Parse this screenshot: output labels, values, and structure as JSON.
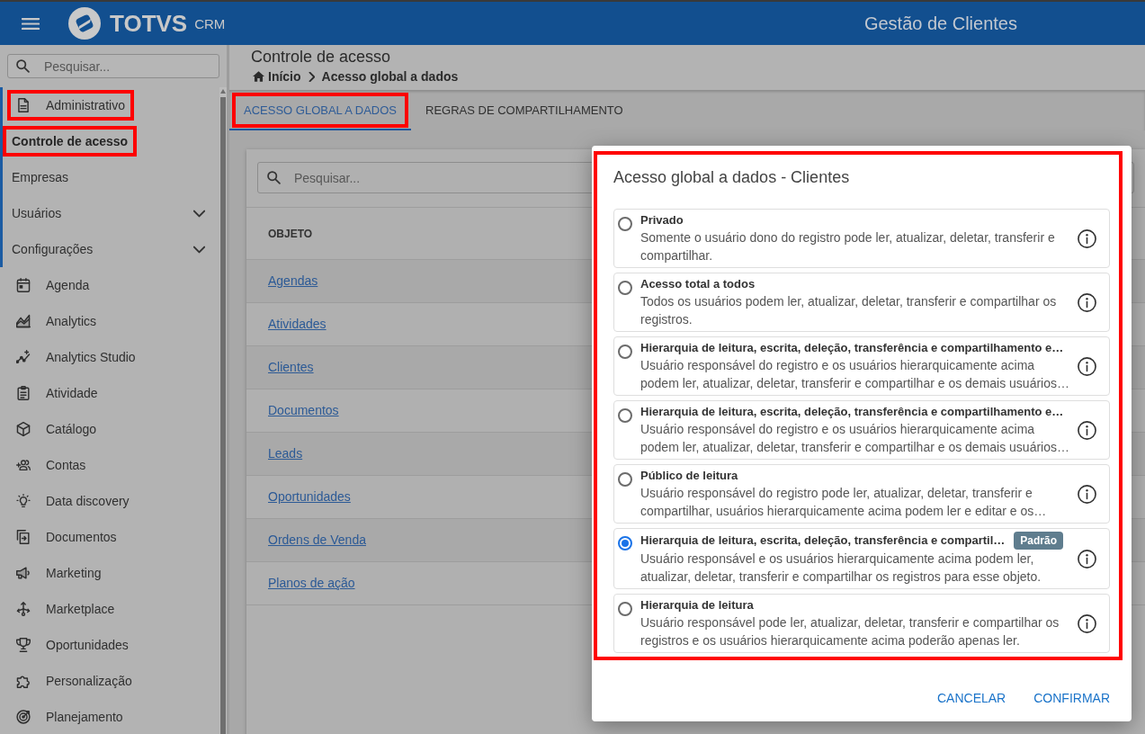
{
  "header": {
    "brand": "TOTVS",
    "product": "CRM",
    "title": "Gestão de Clientes"
  },
  "sidebar": {
    "search": {
      "placeholder": "Pesquisar..."
    },
    "items": [
      {
        "label": "Administrativo",
        "kind": "group",
        "expanded": true,
        "highlighted": true,
        "children": [
          {
            "label": "Controle de acesso",
            "kind": "link",
            "selected": true,
            "highlighted": true
          },
          {
            "label": "Empresas",
            "kind": "link",
            "selected": false,
            "highlighted": false
          },
          {
            "label": "Usuários",
            "kind": "submenu",
            "selected": false,
            "highlighted": false,
            "expanded": false
          },
          {
            "label": "Configurações",
            "kind": "submenu",
            "selected": false,
            "highlighted": false,
            "expanded": false
          }
        ]
      },
      {
        "label": "Agenda",
        "kind": "module",
        "highlighted": false
      },
      {
        "label": "Analytics",
        "kind": "module",
        "highlighted": false
      },
      {
        "label": "Analytics Studio",
        "kind": "module",
        "highlighted": false
      },
      {
        "label": "Atividade",
        "kind": "module",
        "highlighted": false
      },
      {
        "label": "Catálogo",
        "kind": "module",
        "highlighted": false
      },
      {
        "label": "Contas",
        "kind": "module",
        "highlighted": false
      },
      {
        "label": "Data discovery",
        "kind": "module",
        "highlighted": false
      },
      {
        "label": "Documentos",
        "kind": "module",
        "highlighted": false
      },
      {
        "label": "Marketing",
        "kind": "module",
        "highlighted": false
      },
      {
        "label": "Marketplace",
        "kind": "module",
        "highlighted": false
      },
      {
        "label": "Oportunidades",
        "kind": "module",
        "highlighted": false
      },
      {
        "label": "Personalização",
        "kind": "module",
        "highlighted": false
      },
      {
        "label": "Planejamento",
        "kind": "module",
        "highlighted": false
      }
    ]
  },
  "page": {
    "title": "Controle de acesso",
    "breadcrumb": [
      "Início",
      "Acesso global a dados"
    ]
  },
  "tabs": [
    {
      "label": "ACESSO GLOBAL A DADOS",
      "selected": true,
      "highlighted": true
    },
    {
      "label": "REGRAS DE COMPARTILHAMENTO",
      "selected": false,
      "highlighted": false
    }
  ],
  "table": {
    "search": {
      "placeholder": "Pesquisar..."
    },
    "columns": [
      "OBJETO"
    ],
    "rows": [
      [
        "Agendas"
      ],
      [
        "Atividades"
      ],
      [
        "Clientes"
      ],
      [
        "Documentos"
      ],
      [
        "Leads"
      ],
      [
        "Oportunidades"
      ],
      [
        "Ordens de Venda"
      ],
      [
        "Planos de ação"
      ]
    ]
  },
  "dialog": {
    "title": "Acesso global a dados - Clientes",
    "highlighted": true,
    "options": [
      {
        "title": "Privado",
        "description": "Somente o usuário dono do registro pode ler, atualizar, deletar, transferir e compartilhar.",
        "selected": false
      },
      {
        "title": "Acesso total a todos",
        "description": "Todos os usuários podem ler, atualizar, deletar, transferir e compartilhar os registros.",
        "selected": false
      },
      {
        "title": "Hierarquia de leitura, escrita, deleção, transferência e compartilhamento e…",
        "description": "Usuário responsável do registro e os usuários hierarquicamente acima podem ler, atualizar, deletar, transferir e compartilhar e os demais usuários…",
        "selected": false
      },
      {
        "title": "Hierarquia de leitura, escrita, deleção, transferência e compartilhamento e…",
        "description": "Usuário responsável do registro e os usuários hierarquicamente acima podem ler, atualizar, deletar, transferir e compartilhar e os demais usuários…",
        "selected": false
      },
      {
        "title": "Público de leitura",
        "description": "Usuário responsável do registro pode ler, atualizar, deletar, transferir e compartilhar, usuários hierarquicamente acima podem ler e editar e os…",
        "selected": false
      },
      {
        "title": "Hierarquia de leitura, escrita, deleção, transferência e compartil…",
        "badge": "Padrão",
        "description": "Usuário responsável e os usuários hierarquicamente acima podem ler, atualizar, deletar, transferir e compartilhar os registros para esse objeto.",
        "selected": true
      },
      {
        "title": "Hierarquia de leitura",
        "description": "Usuário responsável pode ler, atualizar, deletar, transferir e compartilhar os registros e os usuários hierarquicamente acima poderão apenas ler.",
        "selected": false
      }
    ],
    "buttons": [
      "CANCELAR",
      "CONFIRMAR"
    ]
  }
}
